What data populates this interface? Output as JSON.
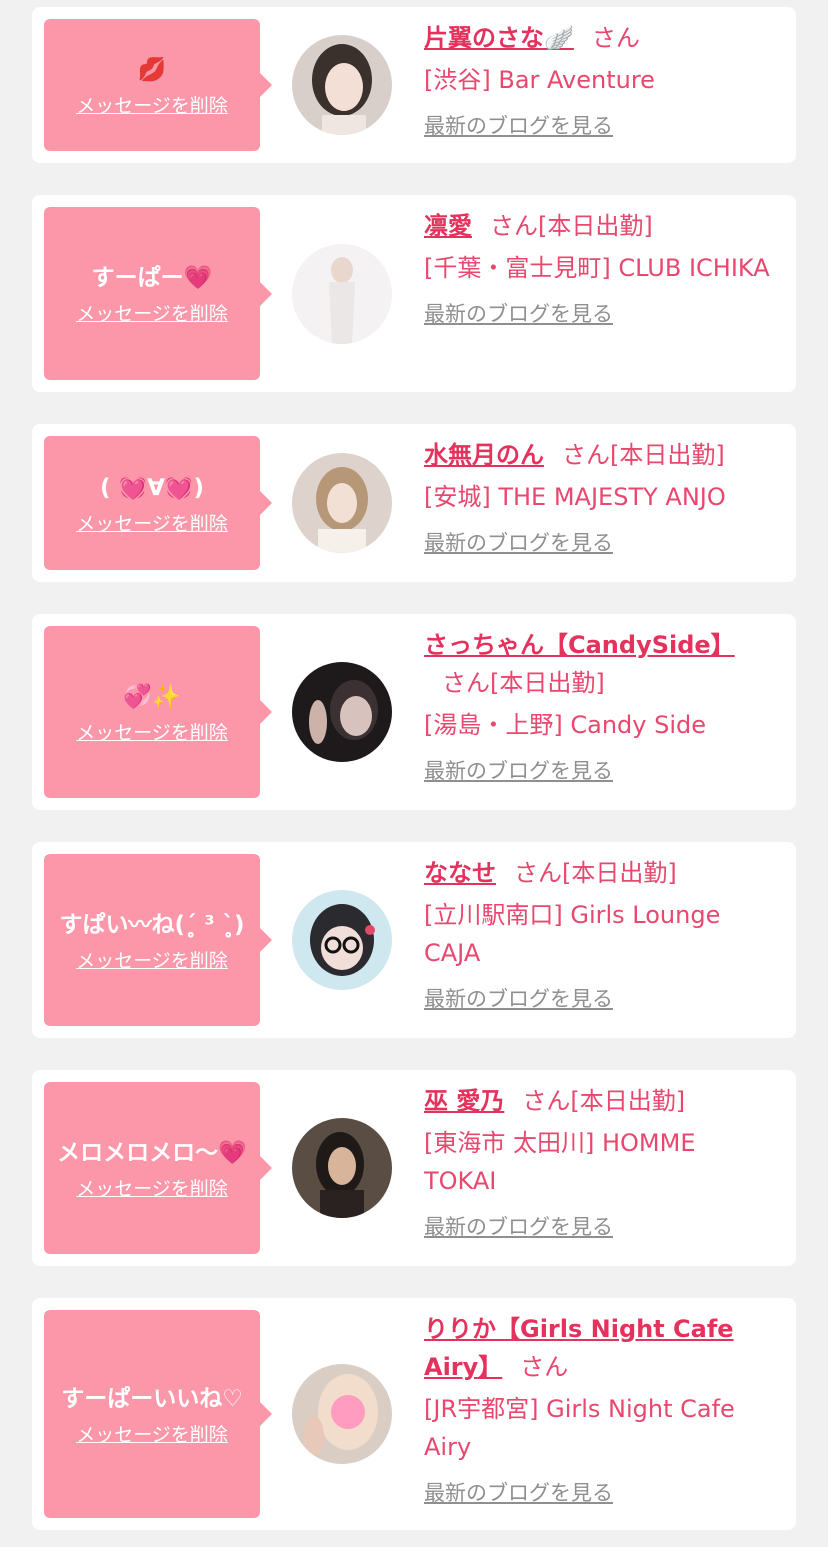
{
  "delete_label": "メッセージを削除",
  "blog_label": "最新のブログを見る",
  "honorific": "さん",
  "colors": {
    "background": "#f1f1f1",
    "card": "#ffffff",
    "bubble": "#fc97aa",
    "name": "#e4325d",
    "shop": "#e8476e",
    "link_gray": "#8f8f8f"
  },
  "items": [
    {
      "message": "💋",
      "name": "片翼のさな🪽",
      "status": "",
      "shop": "[渋谷] Bar Aventure"
    },
    {
      "message": "すーぱー💗",
      "name": "凛愛",
      "status": "[本日出勤]",
      "shop": "[千葉・富士見町] CLUB ICHIKA"
    },
    {
      "message": "( 💓∀💓)",
      "name": "水無月のん",
      "status": "[本日出勤]",
      "shop": "[安城] THE MAJESTY ANJO"
    },
    {
      "message": "💞✨",
      "name": "さっちゃん【CandySide】",
      "status": "[本日出勤]",
      "shop": "[湯島・上野] Candy Side"
    },
    {
      "message": "すぱい〰ね(ˊ̥̥̥̥̥ ³ ˋ̥̥̥̥̥)",
      "name": "ななせ",
      "status": "[本日出勤]",
      "shop": "[立川駅南口] Girls Lounge CAJA"
    },
    {
      "message": "メロメロメロ〜💗",
      "name": "巫 愛乃",
      "status": "[本日出勤]",
      "shop": "[東海市 太田川] HOMME TOKAI"
    },
    {
      "message": "すーぱーいいね♡",
      "name": "りりか【Girls Night Cafe Airy】",
      "status": "",
      "shop": "[JR宇都宮] Girls Night Cafe Airy"
    }
  ]
}
